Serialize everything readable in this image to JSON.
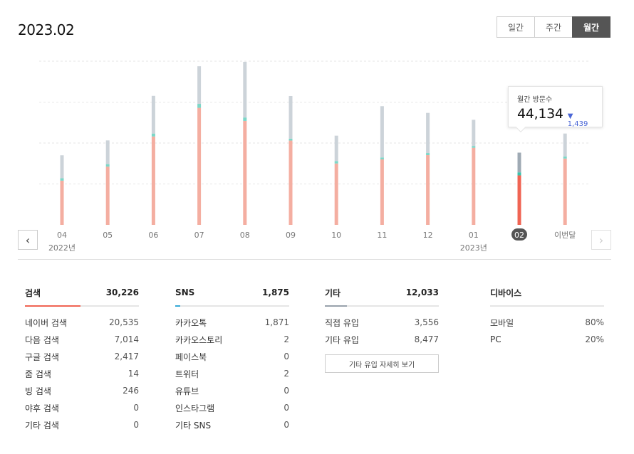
{
  "title": "2023.02",
  "period_tabs": [
    {
      "label": "일간",
      "active": false
    },
    {
      "label": "주간",
      "active": false
    },
    {
      "label": "월간",
      "active": true
    }
  ],
  "colors": {
    "search": "#f4aea1",
    "search_selected": "#f06453",
    "sns": "#7cd7c8",
    "sns_selected": "#3bc2ad",
    "other": "#ccd3d9",
    "other_selected": "#9faab4",
    "sns_line": "#36a9d6",
    "other_line": "#98a2ab",
    "search_line": "#f06453",
    "change_down": "#4a66d6"
  },
  "chart_data": {
    "type": "bar",
    "stacked": true,
    "categories": [
      "04",
      "05",
      "06",
      "07",
      "08",
      "09",
      "10",
      "11",
      "12",
      "01",
      "02",
      "이번달"
    ],
    "year_labels": [
      {
        "index": 0,
        "label": "2022년"
      },
      {
        "index": 9,
        "label": "2023년"
      }
    ],
    "selected_index": 10,
    "series": [
      {
        "key": "search",
        "values": [
          27000,
          35600,
          54000,
          71500,
          63500,
          51500,
          37500,
          40000,
          42600,
          47100,
          30226,
          40500
        ]
      },
      {
        "key": "sns",
        "values": [
          1500,
          1500,
          1800,
          2400,
          2100,
          1200,
          1500,
          1200,
          1300,
          1100,
          1875,
          1300
        ]
      },
      {
        "key": "other",
        "values": [
          14000,
          14500,
          23000,
          23000,
          34000,
          26000,
          15500,
          31300,
          24500,
          16000,
          12033,
          14000
        ]
      }
    ],
    "ylim": [
      0,
      100000
    ],
    "grid": true,
    "tooltip": {
      "label": "월간 방문수",
      "value": "44,134",
      "change": "1,439",
      "change_arrow": "▼"
    }
  },
  "nav": {
    "prev": "‹",
    "next": "›"
  },
  "stats": {
    "search": {
      "title": "검색",
      "total": "30,226",
      "fill": 0.7,
      "rows": [
        {
          "label": "네이버 검색",
          "value": "20,535"
        },
        {
          "label": "다음 검색",
          "value": "7,014"
        },
        {
          "label": "구글 검색",
          "value": "2,417"
        },
        {
          "label": "줌 검색",
          "value": "14"
        },
        {
          "label": "빙 검색",
          "value": "246"
        },
        {
          "label": "야후 검색",
          "value": "0"
        },
        {
          "label": "기타 검색",
          "value": "0"
        }
      ]
    },
    "sns": {
      "title": "SNS",
      "total": "1,875",
      "fill": 0.06,
      "rows": [
        {
          "label": "카카오톡",
          "value": "1,871"
        },
        {
          "label": "카카오스토리",
          "value": "2"
        },
        {
          "label": "페이스북",
          "value": "0"
        },
        {
          "label": "트위터",
          "value": "2"
        },
        {
          "label": "유튜브",
          "value": "0"
        },
        {
          "label": "인스타그램",
          "value": "0"
        },
        {
          "label": "기타 SNS",
          "value": "0"
        }
      ]
    },
    "other": {
      "title": "기타",
      "total": "12,033",
      "fill": 0.28,
      "rows": [
        {
          "label": "직접 유입",
          "value": "3,556"
        },
        {
          "label": "기타 유입",
          "value": "8,477"
        }
      ],
      "detail_button": "기타 유입 자세히 보기"
    },
    "device": {
      "title": "디바이스",
      "rows": [
        {
          "label": "모바일",
          "value": "80%"
        },
        {
          "label": "PC",
          "value": "20%"
        }
      ]
    }
  }
}
